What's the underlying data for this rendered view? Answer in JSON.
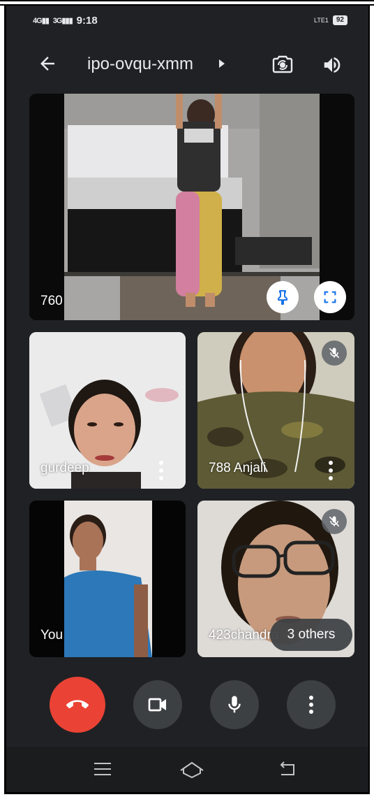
{
  "status_bar": {
    "signal_1": "4G",
    "signal_2": "3G",
    "time": "9:18",
    "network": "LTE1",
    "battery": "92"
  },
  "header": {
    "meeting_code": "ipo-ovqu-xmm",
    "back_icon": "arrow-left-icon",
    "switch_camera_icon": "flip-camera-icon",
    "audio_icon": "speaker-icon"
  },
  "tiles": {
    "main": {
      "label": "760"
    },
    "top_left": {
      "label": "gurdeep"
    },
    "top_right": {
      "label": "788 Anjali",
      "muted": true
    },
    "bottom_left": {
      "label": "You"
    },
    "bottom_right": {
      "label": "423chandra",
      "muted": true,
      "others_chip": "3 others"
    }
  },
  "controls": {
    "end_call_icon": "phone-hangup-icon",
    "camera_icon": "video-camera-icon",
    "mic_icon": "microphone-icon",
    "more_icon": "more-vert-icon",
    "end_color": "#ea4335"
  },
  "colors": {
    "background": "#202124",
    "control_bg": "#3c4043",
    "text": "#e8eaed"
  }
}
